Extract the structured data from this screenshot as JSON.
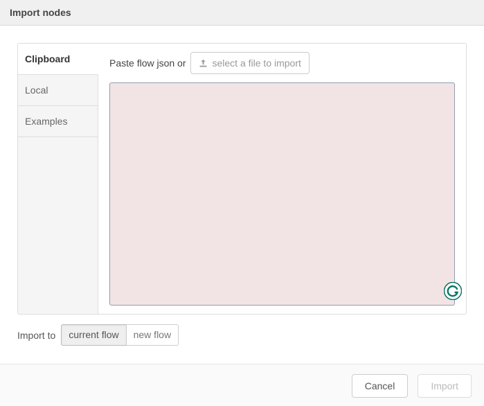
{
  "header": {
    "title": "Import nodes"
  },
  "sidebar": {
    "tabs": [
      {
        "label": "Clipboard",
        "active": true
      },
      {
        "label": "Local",
        "active": false
      },
      {
        "label": "Examples",
        "active": false
      }
    ]
  },
  "content": {
    "paste_label": "Paste flow json or",
    "select_file_label": "select a file to import",
    "textarea_value": ""
  },
  "import_to": {
    "label": "Import to",
    "options": [
      {
        "label": "current flow",
        "active": true
      },
      {
        "label": "new flow",
        "active": false
      }
    ]
  },
  "footer": {
    "cancel": "Cancel",
    "import": "Import"
  }
}
